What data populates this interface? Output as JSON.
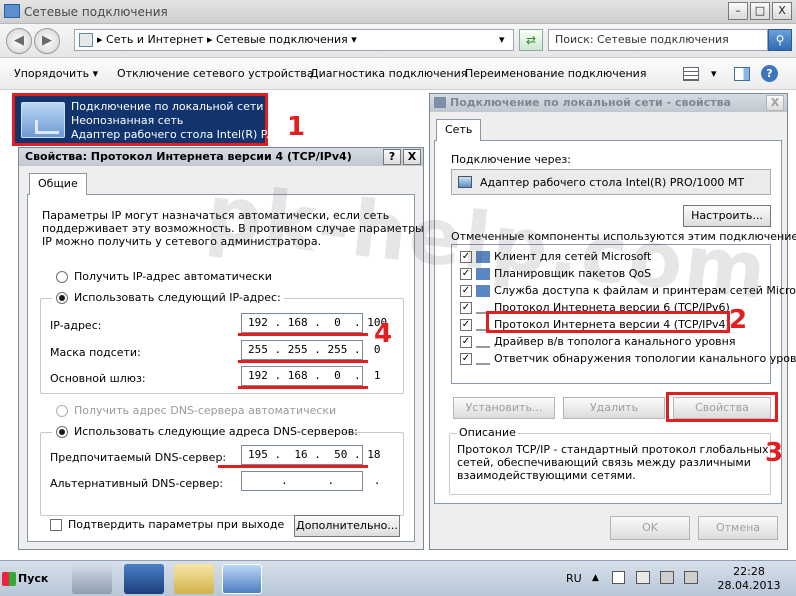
{
  "window": {
    "title": "Сетевые подключения",
    "controls": {
      "min": "–",
      "max": "□",
      "close": "X"
    }
  },
  "address_bar": {
    "crumbs": [
      "Сеть и Интернет",
      "Сетевые подключения"
    ],
    "search_placeholder": "Поиск: Сетевые подключения"
  },
  "toolbar": {
    "items": [
      "Упорядочить",
      "Отключение сетевого устройства",
      "Диагностика подключения",
      "Переименование подключения"
    ]
  },
  "connection": {
    "name": "Подключение по локальной сети",
    "status": "Неопознанная сеть",
    "adapter": "Адаптер рабочего стола Intel(R) P..."
  },
  "annotations": {
    "n1": "1",
    "n2": "2",
    "n3": "3",
    "n4": "4"
  },
  "watermark": "pk-help.com",
  "ipv4_dialog": {
    "title": "Свойства: Протокол Интернета версии 4 (TCP/IPv4)",
    "help_btn": "?",
    "close_btn": "X",
    "tab": "Общие",
    "description": [
      "Параметры IP могут назначаться автоматически, если сеть",
      "поддерживает эту возможность. В противном случае параметры",
      "IP можно получить у сетевого администратора."
    ],
    "auto_ip": "Получить IP-адрес автоматически",
    "manual_ip": "Использовать следующий IP-адрес:",
    "ip_label": "IP-адрес:",
    "mask_label": "Маска подсети:",
    "gateway_label": "Основной шлюз:",
    "ip": "192 . 168 .  0  . 100",
    "mask": "255 . 255 . 255 .  0",
    "gateway": "192 . 168 .  0  .  1",
    "auto_dns": "Получить адрес DNS-сервера автоматически",
    "manual_dns": "Использовать следующие адреса DNS-серверов:",
    "pref_dns_label": "Предпочитаемый DNS-сервер:",
    "alt_dns_label": "Альтернативный DNS-сервер:",
    "pref_dns": "195 .  16 .  50 . 18",
    "alt_dns": "     .      .      .",
    "confirm": "Подтвердить параметры при выходе",
    "advanced": "Дополнительно..."
  },
  "lan_dialog": {
    "title": "Подключение по локальной сети - свойства",
    "close_btn": "X",
    "tab": "Сеть",
    "connect_via": "Подключение через:",
    "adapter": "Адаптер рабочего стола Intel(R) PRO/1000 MT",
    "configure": "Настроить...",
    "components_label": "Отмеченные компоненты используются этим подключением:",
    "components": [
      "Клиент для сетей Microsoft",
      "Планировщик пакетов QoS",
      "Служба доступа к файлам и принтерам сетей Micro...",
      "Протокол Интернета версии 6 (TCP/IPv6)",
      "Протокол Интернета версии 4 (TCP/IPv4)",
      "Драйвер в/в тополога канального уровня",
      "Ответчик обнаружения топологии канального уровня"
    ],
    "install": "Установить...",
    "remove": "Удалить",
    "properties": "Свойства",
    "desc_title": "Описание",
    "desc": [
      "Протокол TCP/IP - стандартный протокол глобальных",
      "сетей, обеспечивающий связь между различными",
      "взаимодействующими сетями."
    ],
    "ok": "OK",
    "cancel": "Отмена"
  },
  "taskbar": {
    "start": "Пуск",
    "lang": "RU",
    "time": "22:28",
    "date": "28.04.2013"
  }
}
